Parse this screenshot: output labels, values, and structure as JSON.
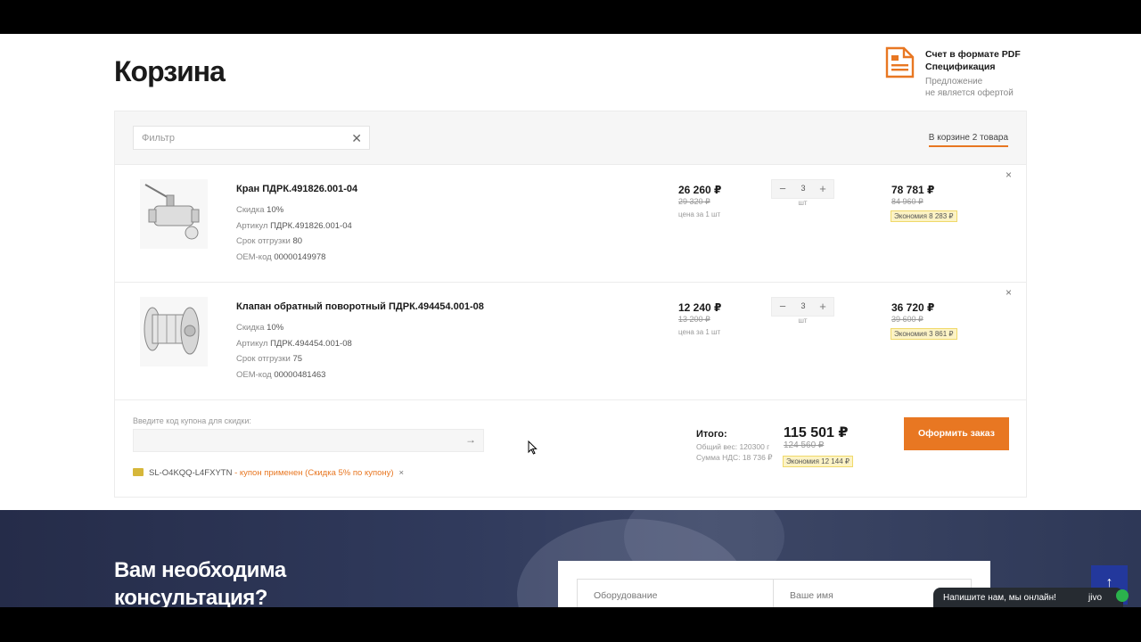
{
  "page": {
    "title": "Корзина"
  },
  "pdf": {
    "invoice_link": "Счет в формате PDF",
    "spec_link": "Спецификация",
    "note_line1": "Предложение",
    "note_line2": "не является офертой"
  },
  "cart": {
    "filter_placeholder": "Фильтр",
    "count_label": "В корзине 2 товара",
    "items": [
      {
        "name": "Кран ПДРК.491826.001-04",
        "discount_label": "Скидка",
        "discount": "10%",
        "sku_label": "Артикул",
        "sku": "ПДРК.491826.001-04",
        "ship_label": "Срок отгрузки",
        "ship": "80",
        "oem_label": "OEM-код",
        "oem": "00000149978",
        "price": "26 260 ₽",
        "price_old": "29 320 ₽",
        "price_unit": "цена за 1 шт",
        "qty": "3",
        "qty_unit": "шт",
        "sum": "78 781 ₽",
        "sum_old": "84 960 ₽",
        "saving": "Экономия 8 283 ₽"
      },
      {
        "name": "Клапан обратный поворотный ПДРК.494454.001-08",
        "discount_label": "Скидка",
        "discount": "10%",
        "sku_label": "Артикул",
        "sku": "ПДРК.494454.001-08",
        "ship_label": "Срок отгрузки",
        "ship": "75",
        "oem_label": "OEM-код",
        "oem": "00000481463",
        "price": "12 240 ₽",
        "price_old": "13 200 ₽",
        "price_unit": "цена за 1 шт",
        "qty": "3",
        "qty_unit": "шт",
        "sum": "36 720 ₽",
        "sum_old": "39 600 ₽",
        "saving": "Экономия 3 861 ₽"
      }
    ],
    "coupon": {
      "label": "Введите код купона для скидки:",
      "value": "",
      "applied_code": "SL-O4KQQ-L4FXYTN",
      "applied_msg": " - купон применен (Скидка 5% по купону)"
    },
    "totals": {
      "label": "Итого:",
      "weight": "Общий вес: 120300 г",
      "vat": "Сумма НДС: 18 736 ₽",
      "total": "115 501 ₽",
      "total_old": "124 560 ₽",
      "saving": "Экономия 12 144 ₽",
      "order_button": "Оформить заказ"
    }
  },
  "consult": {
    "title_line1": "Вам необходима",
    "title_line2": "консультация?",
    "field_equipment": "Оборудование",
    "field_name": "Ваше имя"
  },
  "chat": {
    "label": "Напишите нам, мы онлайн!",
    "brand": "jivo"
  },
  "icons": {
    "pdf": "document-icon",
    "remove": "close-icon",
    "clear": "close-icon",
    "submit": "arrow-right-icon",
    "scroll_up": "arrow-up-icon",
    "coupon": "ticket-icon"
  },
  "colors": {
    "accent": "#e87722",
    "saving_bg": "#fcf3c5",
    "up_button": "#23389c",
    "consult_bg": "#2e3857"
  }
}
